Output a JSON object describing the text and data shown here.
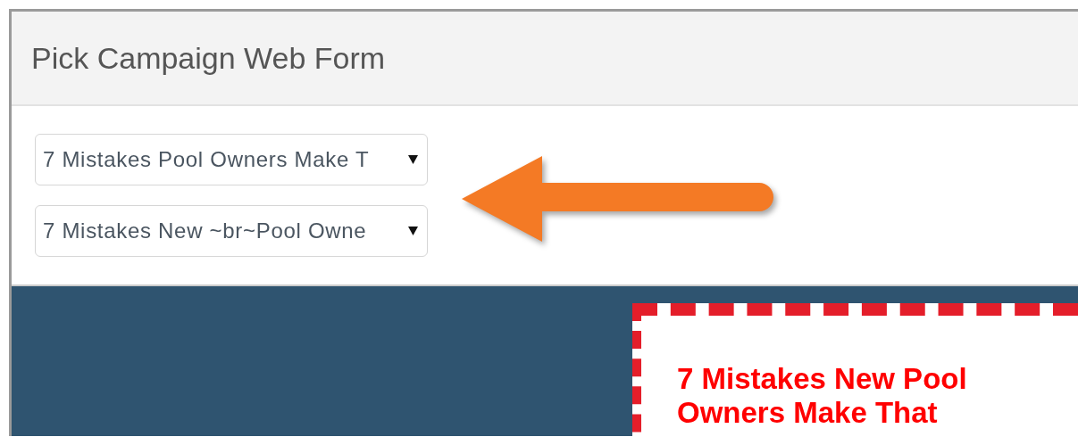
{
  "panel": {
    "title": "Pick Campaign Web Form"
  },
  "dropdowns": [
    {
      "value": "7 Mistakes Pool Owners Make T"
    },
    {
      "value": "7 Mistakes New ~br~Pool Owne"
    }
  ],
  "preview": {
    "headline": "7 Mistakes New Pool Owners Make That"
  }
}
